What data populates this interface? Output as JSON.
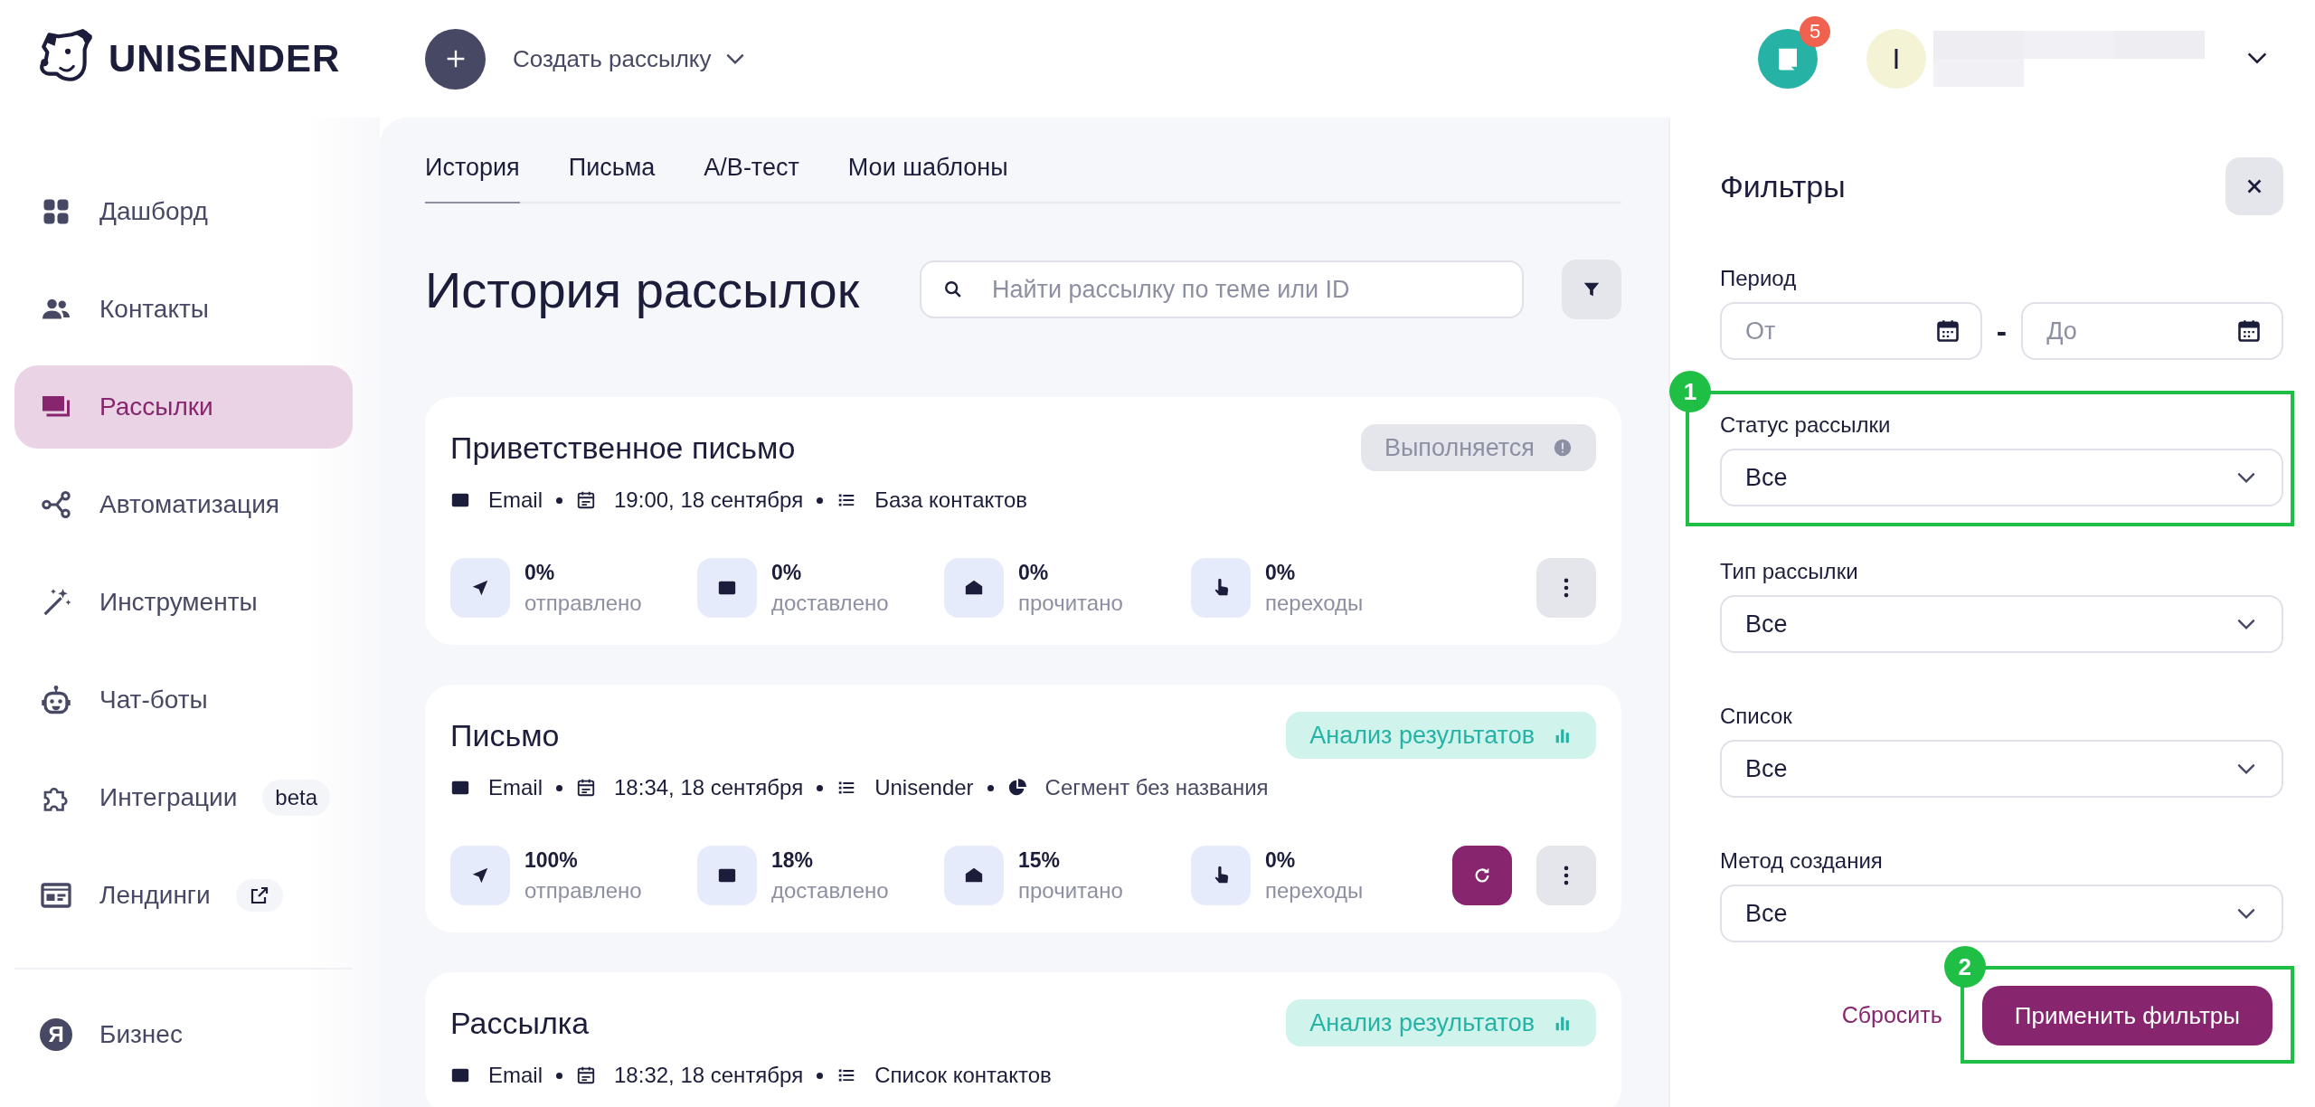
{
  "header": {
    "logo": {
      "text": "UNISENDER"
    },
    "create_button": {
      "label": "Создать рассылку"
    },
    "chat": {
      "badge": "5"
    },
    "avatar": {
      "initial": "I"
    }
  },
  "sidebar": {
    "items": [
      {
        "kind": "dashboard",
        "label": "Дашборд",
        "selected": false
      },
      {
        "kind": "contacts",
        "label": "Контакты",
        "selected": false
      },
      {
        "kind": "mailings",
        "label": "Рассылки",
        "selected": true
      },
      {
        "kind": "automation",
        "label": "Автоматизация",
        "selected": false
      },
      {
        "kind": "tools",
        "label": "Инструменты",
        "selected": false
      },
      {
        "kind": "chatbots",
        "label": "Чат-боты",
        "selected": false
      },
      {
        "kind": "integrations",
        "label": "Интеграции",
        "selected": false,
        "badge": "beta"
      },
      {
        "kind": "landings",
        "label": "Лендинги",
        "selected": false,
        "external_link": true
      }
    ],
    "bottom_items": [
      {
        "kind": "business",
        "label": "Бизнес",
        "selected": false,
        "icon_glyph": "Я"
      }
    ]
  },
  "main": {
    "tabs": [
      {
        "label": "История",
        "selected": true
      },
      {
        "label": "Письма",
        "selected": false
      },
      {
        "label": "А/В-тест",
        "selected": false
      },
      {
        "label": "Мои шаблоны",
        "selected": false
      }
    ],
    "title": "История рассылок",
    "search": {
      "placeholder": "Найти рассылку по теме или ID"
    },
    "campaigns": [
      {
        "title": "Приветственное письмо",
        "status": {
          "kind": "running",
          "label": "Выполняется"
        },
        "meta": [
          {
            "kind": "channel",
            "text": "Email"
          },
          {
            "kind": "date",
            "text": "19:00, 18 сентября"
          },
          {
            "kind": "list",
            "text": "База контактов"
          }
        ],
        "stats": [
          {
            "kind": "sent",
            "value": "0%",
            "label": "отправлено"
          },
          {
            "kind": "delivered",
            "value": "0%",
            "label": "доставлено"
          },
          {
            "kind": "read",
            "value": "0%",
            "label": "прочитано"
          },
          {
            "kind": "clicks",
            "value": "0%",
            "label": "переходы"
          }
        ],
        "buttons": [
          {
            "kind": "menu"
          }
        ]
      },
      {
        "title": "Письмо",
        "status": {
          "kind": "analysis",
          "label": "Анализ результатов"
        },
        "meta": [
          {
            "kind": "channel",
            "text": "Email"
          },
          {
            "kind": "date",
            "text": "18:34, 18 сентября"
          },
          {
            "kind": "list",
            "text": "Unisender"
          },
          {
            "kind": "segment",
            "text": "Сегмент без названия"
          }
        ],
        "stats": [
          {
            "kind": "sent",
            "value": "100%",
            "label": "отправлено"
          },
          {
            "kind": "delivered",
            "value": "18%",
            "label": "доставлено"
          },
          {
            "kind": "read",
            "value": "15%",
            "label": "прочитано"
          },
          {
            "kind": "clicks",
            "value": "0%",
            "label": "переходы"
          }
        ],
        "buttons": [
          {
            "kind": "refresh"
          },
          {
            "kind": "menu"
          }
        ]
      },
      {
        "title": "Рассылка",
        "status": {
          "kind": "analysis",
          "label": "Анализ результатов"
        },
        "meta": [
          {
            "kind": "channel",
            "text": "Email"
          },
          {
            "kind": "date",
            "text": "18:32, 18 сентября"
          },
          {
            "kind": "list",
            "text": "Список контактов"
          }
        ]
      }
    ]
  },
  "filters": {
    "title": "Фильтры",
    "period": {
      "label": "Период",
      "from": {
        "placeholder": "От"
      },
      "separator": "-",
      "to": {
        "placeholder": "До"
      }
    },
    "selects": [
      {
        "label": "Статус рассылки",
        "value": "Все",
        "annotation": "1"
      },
      {
        "label": "Тип рассылки",
        "value": "Все"
      },
      {
        "label": "Список",
        "value": "Все"
      },
      {
        "label": "Метод создания",
        "value": "Все"
      }
    ],
    "reset": "Сбросить",
    "apply": {
      "label": "Применить фильтры",
      "annotation": "2"
    }
  }
}
